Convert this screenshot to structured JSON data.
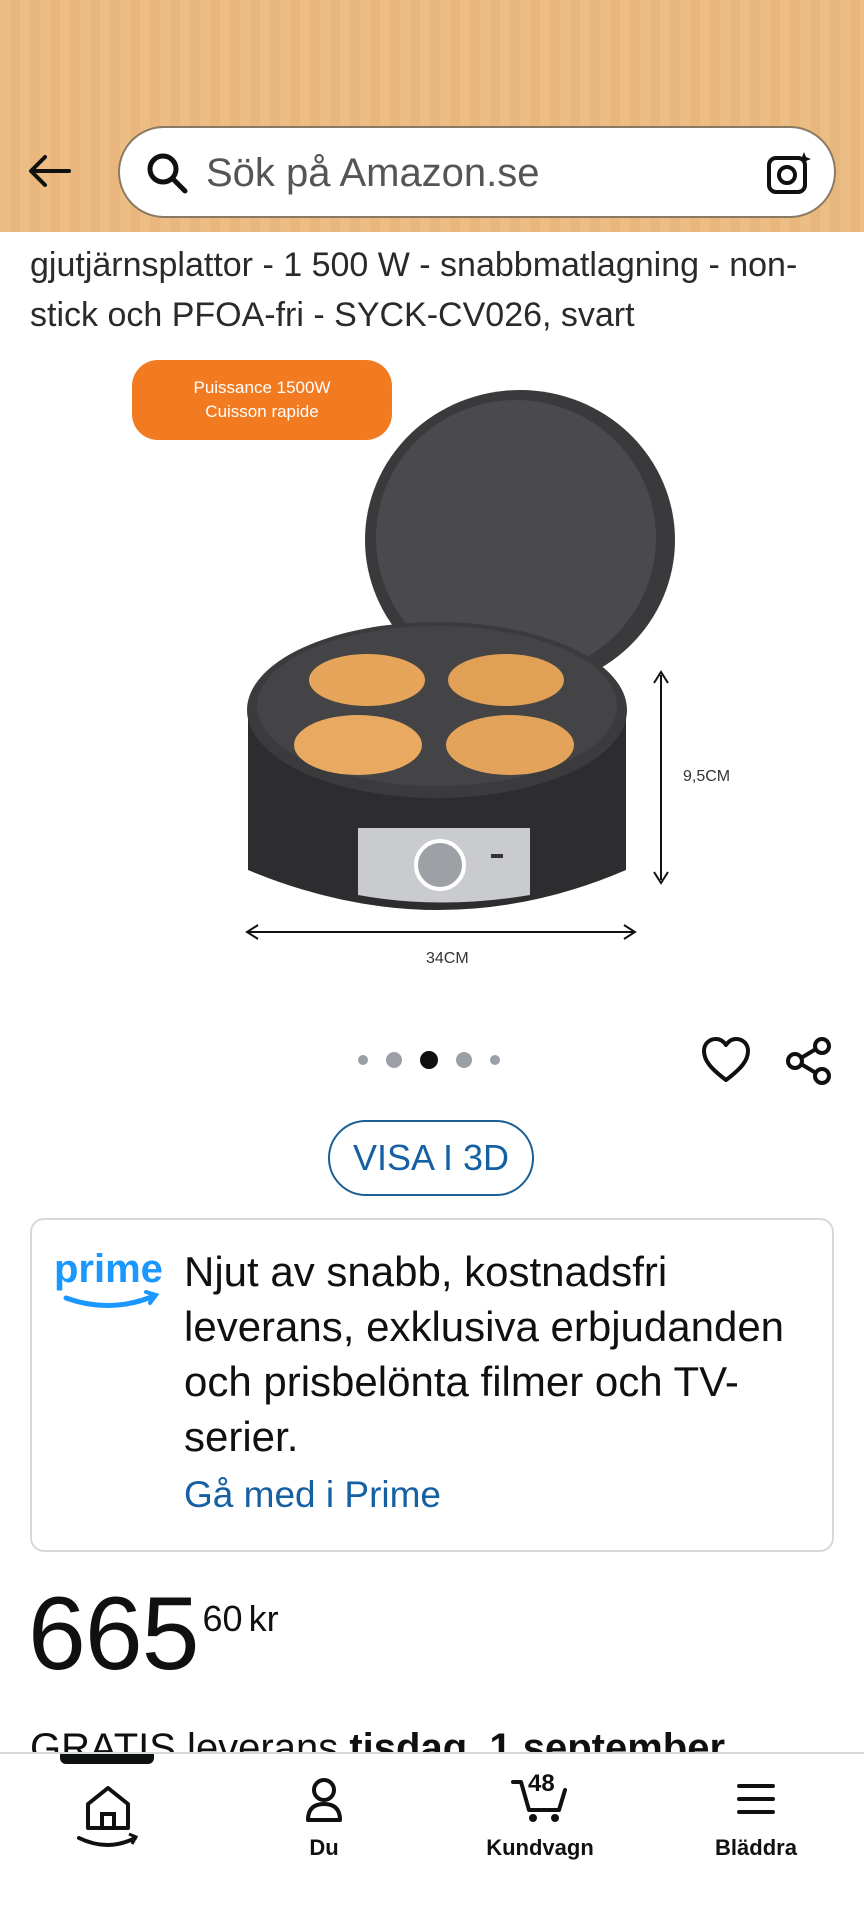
{
  "header": {
    "search_placeholder": "Sök på Amazon.se"
  },
  "product": {
    "title": "gjutjärnsplattor - 1 500 W - snabbmatlagning - non-stick och PFOA-fri - SYCK-CV026, svart",
    "badge_line1": "Puissance 1500W",
    "badge_line2": "Cuisson rapide",
    "height_label": "9,5CM",
    "width_label": "34CM",
    "carousel_dots": 5,
    "carousel_active": 3
  },
  "actions": {
    "view_3d": "VISA I 3D"
  },
  "prime": {
    "logo_text": "prime",
    "description": "Njut av snabb, kostnadsfri leverans, exklusiva erbjudanden och prisbelönta filmer och TV-serier.",
    "link": "Gå med i Prime"
  },
  "price": {
    "whole": "665",
    "fraction": "60",
    "currency": "kr"
  },
  "delivery": {
    "prefix": "GRATIS leverans ",
    "date": "tisdag, 1 september"
  },
  "bottom_nav": {
    "items": [
      {
        "label": "",
        "icon": "home-icon"
      },
      {
        "label": "Du",
        "icon": "user-icon"
      },
      {
        "label": "Kundvagn",
        "icon": "cart-icon"
      },
      {
        "label": "Bläddra",
        "icon": "menu-icon"
      }
    ],
    "cart_count": "48"
  },
  "colors": {
    "header_bg": "#ecbd84",
    "link_blue": "#1560a3",
    "badge_orange": "#f27a21"
  }
}
